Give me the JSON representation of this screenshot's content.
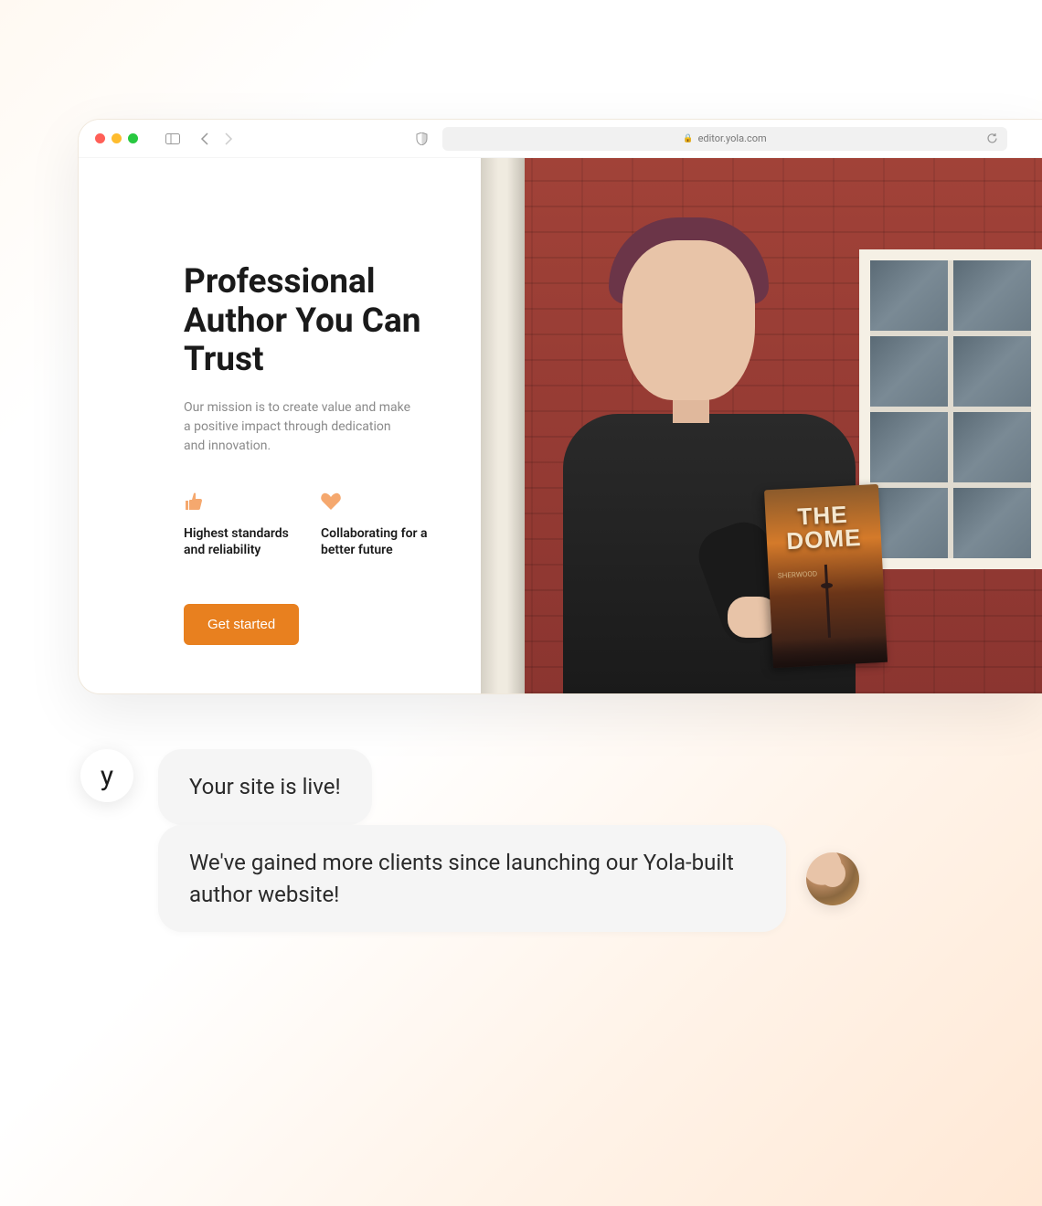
{
  "browser": {
    "url": "editor.yola.com"
  },
  "hero": {
    "headline": "Professional Author You Can Trust",
    "subtext": "Our mission is to create value and make a positive impact through dedication and innovation.",
    "features": [
      {
        "label": "Highest standards and reliability"
      },
      {
        "label": "Collaborating for a better future"
      }
    ],
    "cta": "Get started",
    "book": {
      "title": "THE DOME",
      "author": "SHERWOOD"
    }
  },
  "chat": {
    "avatar_letter": "y",
    "bubble1": "Your site is live!",
    "bubble2": "We've gained more clients since launching our Yola-built author website!"
  }
}
